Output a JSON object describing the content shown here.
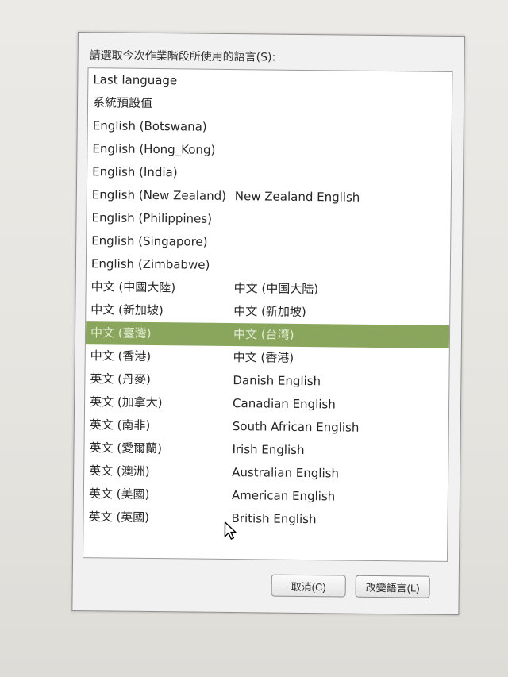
{
  "dialog": {
    "prompt": "請選取今次作業階段所使用的語言(S):",
    "languages": [
      {
        "name": "Last language",
        "desc": ""
      },
      {
        "name": "系統預設值",
        "desc": ""
      },
      {
        "name": "English (Botswana)",
        "desc": ""
      },
      {
        "name": "English (Hong_Kong)",
        "desc": ""
      },
      {
        "name": "English (India)",
        "desc": ""
      },
      {
        "name": "English (New Zealand)",
        "desc": "New Zealand English"
      },
      {
        "name": "English (Philippines)",
        "desc": ""
      },
      {
        "name": "English (Singapore)",
        "desc": ""
      },
      {
        "name": "English (Zimbabwe)",
        "desc": ""
      },
      {
        "name": "中文 (中國大陸)",
        "desc": "中文 (中国大陆)"
      },
      {
        "name": "中文 (新加坡)",
        "desc": "中文 (新加坡)"
      },
      {
        "name": "中文 (臺灣)",
        "desc": "中文 (台湾)"
      },
      {
        "name": "中文 (香港)",
        "desc": "中文 (香港)"
      },
      {
        "name": "英文 (丹麥)",
        "desc": "Danish English"
      },
      {
        "name": "英文 (加拿大)",
        "desc": "Canadian English"
      },
      {
        "name": "英文 (南非)",
        "desc": "South African English"
      },
      {
        "name": "英文 (愛爾蘭)",
        "desc": "Irish English"
      },
      {
        "name": "英文 (澳洲)",
        "desc": "Australian English"
      },
      {
        "name": "英文 (美國)",
        "desc": "American English"
      },
      {
        "name": "英文 (英國)",
        "desc": "British English"
      }
    ],
    "selected_name": "中文 (臺灣)",
    "buttons": {
      "cancel": "取消(C)",
      "change": "改變語言(L)"
    }
  },
  "colors": {
    "selection": "#8aa65d"
  },
  "icons": {
    "pointer": "mouse-pointer-icon"
  }
}
